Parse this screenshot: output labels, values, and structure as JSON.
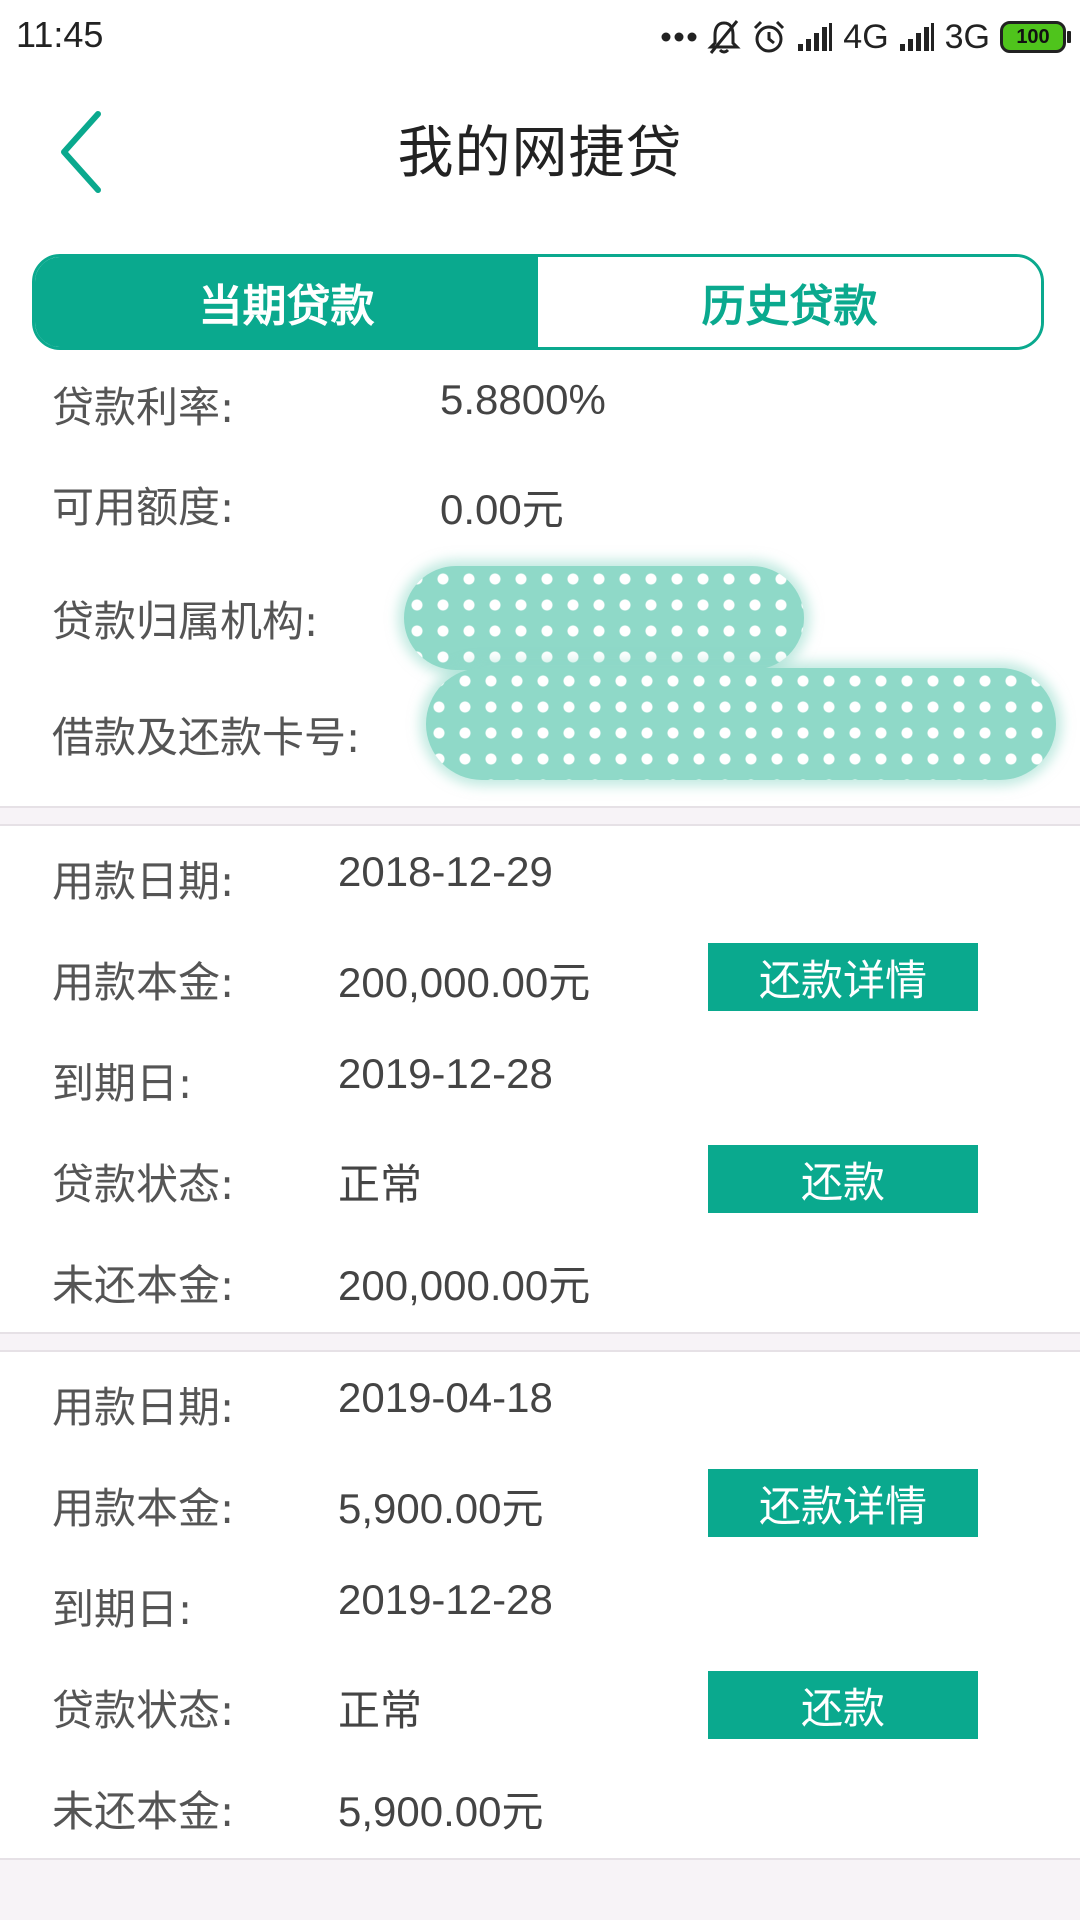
{
  "status_bar": {
    "time": "11:45",
    "network_1": "4G",
    "network_2": "3G",
    "battery": "100",
    "icons": [
      "more-dots-icon",
      "mute-bell-icon",
      "alarm-icon",
      "signal-icon",
      "signal-icon",
      "battery-icon"
    ]
  },
  "header": {
    "title": "我的网捷贷",
    "back_icon": "chevron-left-icon"
  },
  "tabs": [
    {
      "label": "当期贷款",
      "active": true
    },
    {
      "label": "历史贷款",
      "active": false
    }
  ],
  "info": {
    "rate_label": "贷款利率:",
    "rate_value": "5.8800%",
    "available_label": "可用额度:",
    "available_value": "0.00元",
    "institution_label": "贷款归属机构:",
    "card_label": "借款及还款卡号:"
  },
  "loans": [
    {
      "date_label": "用款日期:",
      "date_value": "2018-12-29",
      "principal_label": "用款本金:",
      "principal_value": "200,000.00元",
      "due_label": "到期日:",
      "due_value": "2019-12-28",
      "status_label": "贷款状态:",
      "status_value": "正常",
      "remaining_label": "未还本金:",
      "remaining_value": "200,000.00元",
      "detail_button": "还款详情",
      "repay_button": "还款"
    },
    {
      "date_label": "用款日期:",
      "date_value": "2019-04-18",
      "principal_label": "用款本金:",
      "principal_value": "5,900.00元",
      "due_label": "到期日:",
      "due_value": "2019-12-28",
      "status_label": "贷款状态:",
      "status_value": "正常",
      "remaining_label": "未还本金:",
      "remaining_value": "5,900.00元",
      "detail_button": "还款详情",
      "repay_button": "还款"
    }
  ],
  "colors": {
    "accent": "#0aa98e",
    "background": "#f7f3f7",
    "redaction": "#8fd9c8"
  }
}
